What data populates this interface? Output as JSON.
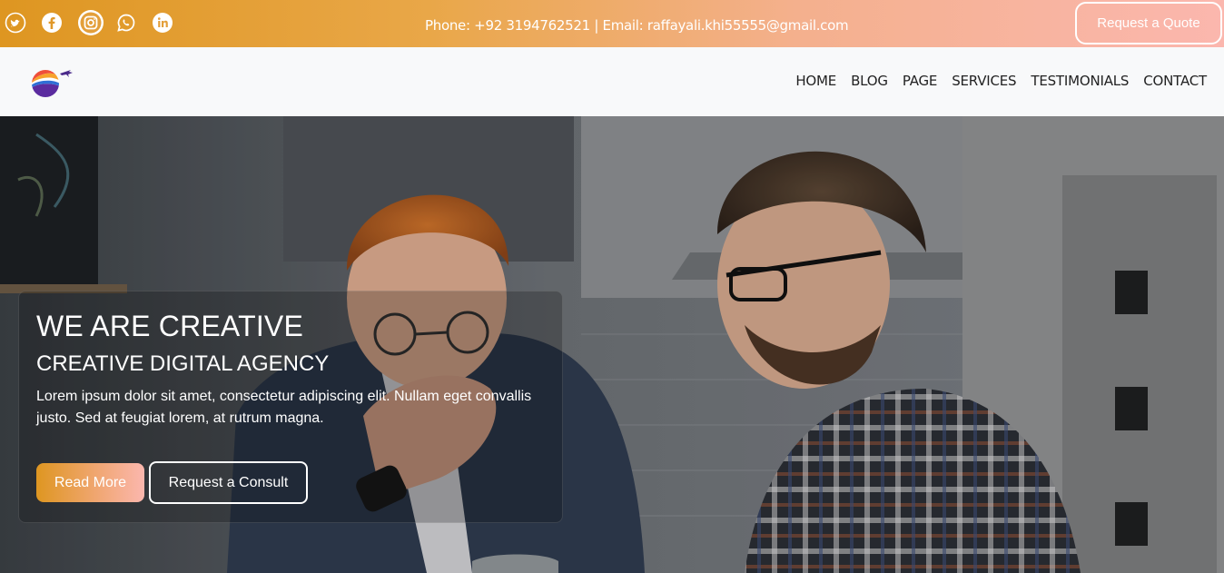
{
  "topbar": {
    "social_icons": [
      "twitter-icon",
      "facebook-icon",
      "instagram-icon",
      "whatsapp-icon",
      "linkedin-icon"
    ],
    "contact_text": "Phone: +92 3194762521 | Email: raffayali.khi55555@gmail.com",
    "quote_label": "Request a Quote",
    "colors": {
      "gradient_start": "#de9621",
      "gradient_end": "#fbb7ae"
    }
  },
  "nav": {
    "items": [
      "HOME",
      "BLOG",
      "PAGE",
      "SERVICES",
      "TESTIMONIALS",
      "CONTACT"
    ]
  },
  "hero": {
    "title": "WE ARE CREATIVE",
    "subtitle": "CREATIVE DIGITAL AGENCY",
    "description": "Lorem ipsum dolor sit amet, consectetur adipiscing elit. Nullam eget convallis justo. Sed at feugiat lorem, at rutrum magna.",
    "read_more_label": "Read More",
    "consult_label": "Request a Consult"
  }
}
